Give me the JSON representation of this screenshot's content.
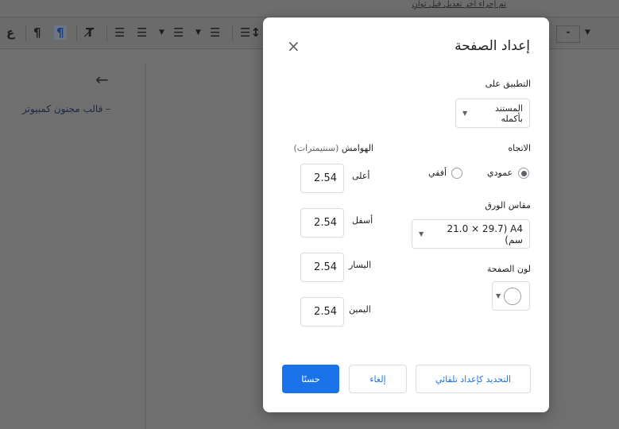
{
  "header": {
    "last_edit": "تم إجراء آخر تعديل قبل ثوانٍ"
  },
  "toolbar": {
    "letter_icon": "ع",
    "zoom_value": "-"
  },
  "sidebar": {
    "outline_item": "قالب مجنون كمبيوتر",
    "outline_dash": "–"
  },
  "dialog": {
    "title": "إعداد الصفحة",
    "close": "×",
    "apply_to_label": "التطبيق على",
    "apply_to_value": "المستند بأكمله",
    "orientation_label": "الاتجاه",
    "portrait": "عمودي",
    "landscape": "أفقي",
    "paper_size_label": "مقاس الورق",
    "paper_size_value": "A4 (21.0 × 29.7 سم)",
    "page_color_label": "لون الصفحة",
    "margins_label": "الهوامش",
    "margins_unit": "(سنتيمترات)",
    "margins": [
      {
        "label": "أعلى",
        "value": "2.54"
      },
      {
        "label": "أسفل",
        "value": "2.54"
      },
      {
        "label": "اليسار",
        "value": "2.54"
      },
      {
        "label": "اليمين",
        "value": "2.54"
      }
    ],
    "set_default": "التحديد كإعداد تلقائي",
    "cancel": "إلغاء",
    "ok": "حسنًا"
  },
  "colors": {
    "accent": "#1a73e8"
  }
}
